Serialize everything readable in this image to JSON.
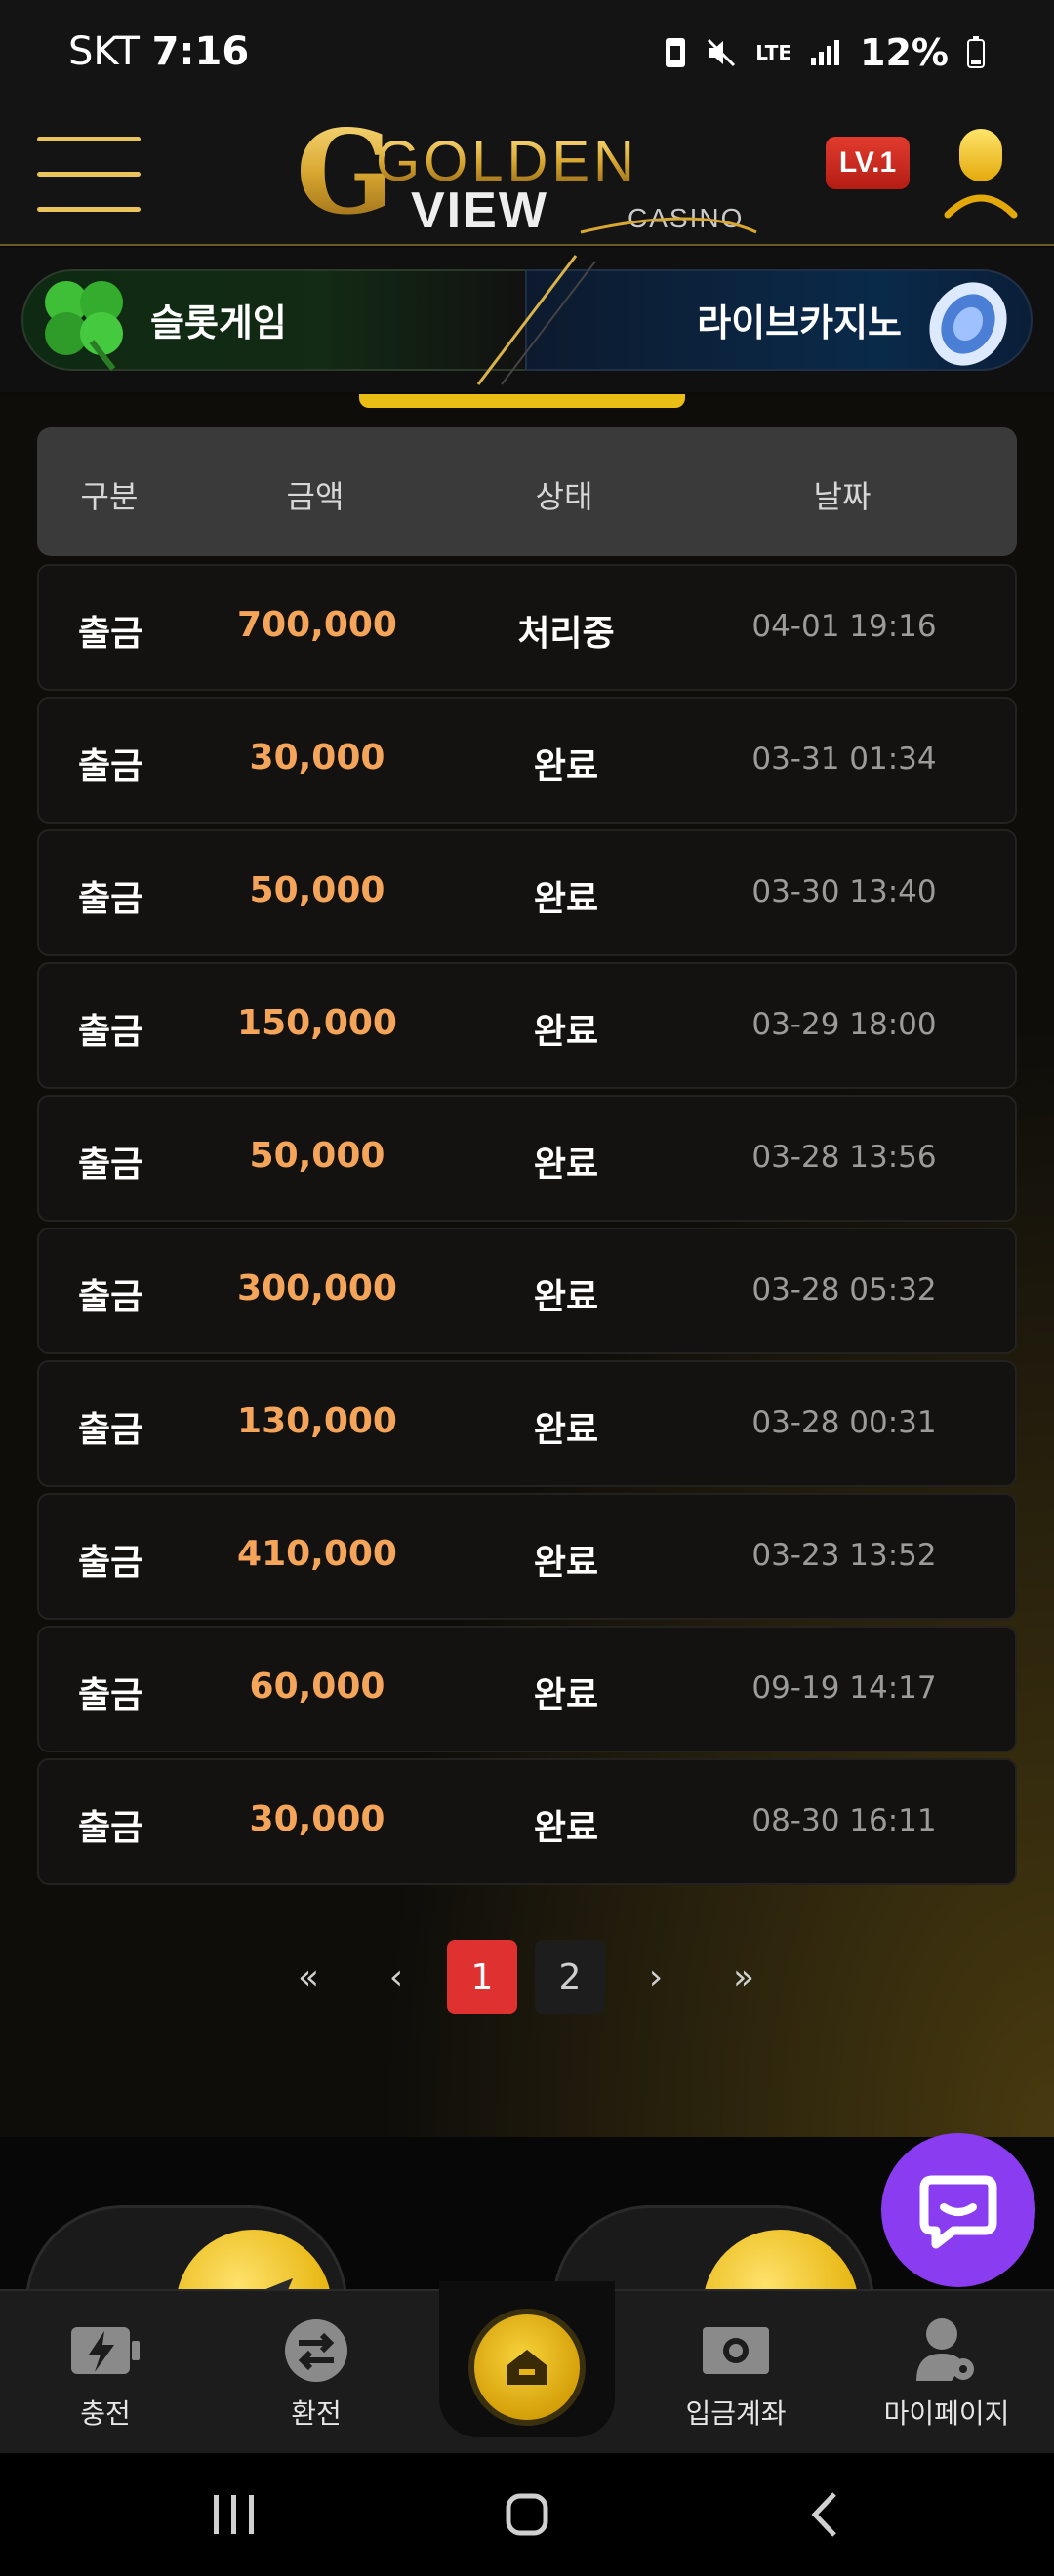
{
  "status_bar": {
    "carrier": "SKT",
    "time": "7:16",
    "network": "LTE",
    "battery": "12%"
  },
  "header": {
    "logo_main": "GOLDEN",
    "logo_sub": "VIEW",
    "logo_casino": "CASINO",
    "level_badge": "LV.1"
  },
  "banner": {
    "slot_label": "슬롯게임",
    "live_label": "라이브카지노"
  },
  "table": {
    "headers": {
      "type": "구분",
      "amount": "금액",
      "status": "상태",
      "date": "날짜"
    },
    "rows": [
      {
        "type": "출금",
        "amount": "700,000",
        "status": "처리중",
        "date": "04-01 19:16"
      },
      {
        "type": "출금",
        "amount": "30,000",
        "status": "완료",
        "date": "03-31 01:34"
      },
      {
        "type": "출금",
        "amount": "50,000",
        "status": "완료",
        "date": "03-30 13:40"
      },
      {
        "type": "출금",
        "amount": "150,000",
        "status": "완료",
        "date": "03-29 18:00"
      },
      {
        "type": "출금",
        "amount": "50,000",
        "status": "완료",
        "date": "03-28 13:56"
      },
      {
        "type": "출금",
        "amount": "300,000",
        "status": "완료",
        "date": "03-28 05:32"
      },
      {
        "type": "출금",
        "amount": "130,000",
        "status": "완료",
        "date": "03-28 00:31"
      },
      {
        "type": "출금",
        "amount": "410,000",
        "status": "완료",
        "date": "03-23 13:52"
      },
      {
        "type": "출금",
        "amount": "60,000",
        "status": "완료",
        "date": "09-19 14:17"
      },
      {
        "type": "출금",
        "amount": "30,000",
        "status": "완료",
        "date": "08-30 16:11"
      }
    ]
  },
  "pagination": {
    "first": "«",
    "prev": "‹",
    "pages": [
      "1",
      "2"
    ],
    "current": "1",
    "next": "›",
    "last": "»"
  },
  "bottom_nav": {
    "charge": "충전",
    "exchange": "환전",
    "deposit_account": "입금계좌",
    "my_page": "마이페이지"
  },
  "colors": {
    "accent_gold": "#e9bd14",
    "amount_orange": "#f5a55a",
    "active_page_red": "#e03131",
    "chat_purple": "#8a3cf0"
  },
  "icons": {
    "menu": "hamburger-menu-icon",
    "user": "user-icon",
    "clover": "clover-icon",
    "chip": "poker-chip-icon",
    "chat": "chat-icon",
    "charge": "lightning-battery-icon",
    "exchange": "swap-arrows-icon",
    "home": "home-icon",
    "deposit": "cash-icon",
    "mypage": "user-gear-icon"
  }
}
